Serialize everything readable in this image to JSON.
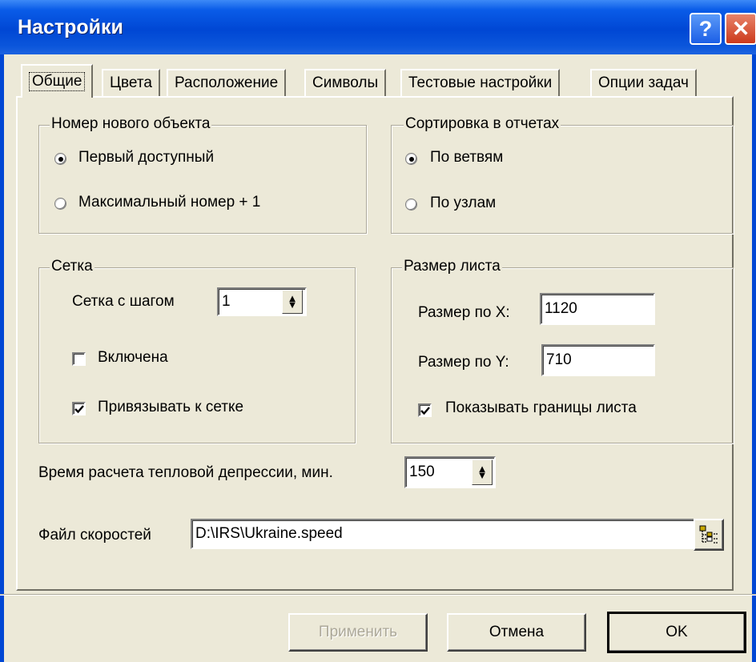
{
  "window": {
    "title": "Настройки",
    "help_glyph": "?",
    "close_glyph": "✕",
    "titlebar_color": "#0047d4",
    "face_color": "#ece9d8"
  },
  "tabs": [
    {
      "label": "Общие",
      "active": true
    },
    {
      "label": "Цвета",
      "active": false
    },
    {
      "label": "Расположение",
      "active": false
    },
    {
      "label": "Символы",
      "active": false
    },
    {
      "label": "Тестовые настройки",
      "active": false
    },
    {
      "label": "Опции задач",
      "active": false
    }
  ],
  "new_object": {
    "legend": "Номер нового объекта",
    "options": [
      {
        "label": "Первый доступный",
        "selected": true
      },
      {
        "label": "Максимальный номер + 1",
        "selected": false
      }
    ]
  },
  "report_sort": {
    "legend": "Сортировка в отчетах",
    "options": [
      {
        "label": "По ветвям",
        "selected": true
      },
      {
        "label": "По узлам",
        "selected": false
      }
    ]
  },
  "grid": {
    "legend": "Сетка",
    "step_label": "Сетка с шагом",
    "step_value": "1",
    "enabled_label": "Включена",
    "enabled_checked": false,
    "snap_label": "Привязывать к сетке",
    "snap_checked": true
  },
  "sheet": {
    "legend": "Размер листа",
    "x_label": "Размер по X:",
    "x_value": "1120",
    "y_label": "Размер по Y:",
    "y_value": "710",
    "borders_label": "Показывать границы листа",
    "borders_checked": true
  },
  "heat_time": {
    "label": "Время расчета тепловой депрессии, мин.",
    "value": "150"
  },
  "speed_file": {
    "label": "Файл скоростей",
    "value": "D:\\IRS\\Ukraine.speed",
    "browse_icon": "tree-browse-icon"
  },
  "buttons": {
    "apply": "Применить",
    "cancel": "Отмена",
    "ok": "OK"
  }
}
